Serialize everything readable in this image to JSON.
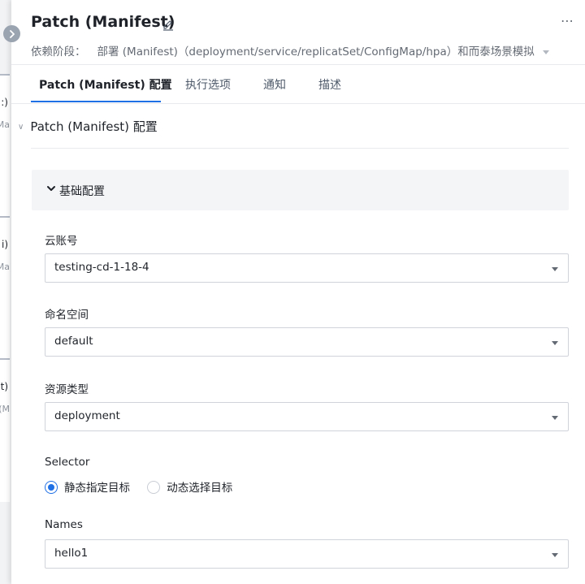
{
  "header": {
    "title": "Patch (Manifest)",
    "stage_label": "依赖阶段：",
    "stage_value": "部署 (Manifest)（deployment/service/replicatSet/ConfigMap/hpa）和而泰场景模拟"
  },
  "background_cards": [
    {
      "line1": ":)",
      "line2": "Ma"
    },
    {
      "line1": "i)",
      "line2": "Ma"
    },
    {
      "line1": "t)",
      "line2": "(M"
    }
  ],
  "tabs": [
    {
      "label": "Patch (Manifest) 配置",
      "active": true
    },
    {
      "label": "执行选项",
      "active": false
    },
    {
      "label": "通知",
      "active": false
    },
    {
      "label": "描述",
      "active": false
    }
  ],
  "section": {
    "title": "Patch (Manifest) 配置",
    "group_title": "基础配置"
  },
  "form": {
    "cloud_account": {
      "label": "云账号",
      "value": "testing-cd-1-18-4"
    },
    "namespace": {
      "label": "命名空间",
      "value": "default"
    },
    "resource_type": {
      "label": "资源类型",
      "value": "deployment"
    },
    "selector": {
      "label": "Selector",
      "options": [
        {
          "label": "静态指定目标",
          "checked": true
        },
        {
          "label": "动态选择目标",
          "checked": false
        }
      ]
    },
    "names": {
      "label": "Names",
      "value": "hello1"
    }
  },
  "colors": {
    "accent": "#1f6fe5",
    "text": "#1f2329",
    "muted": "#646a73"
  }
}
